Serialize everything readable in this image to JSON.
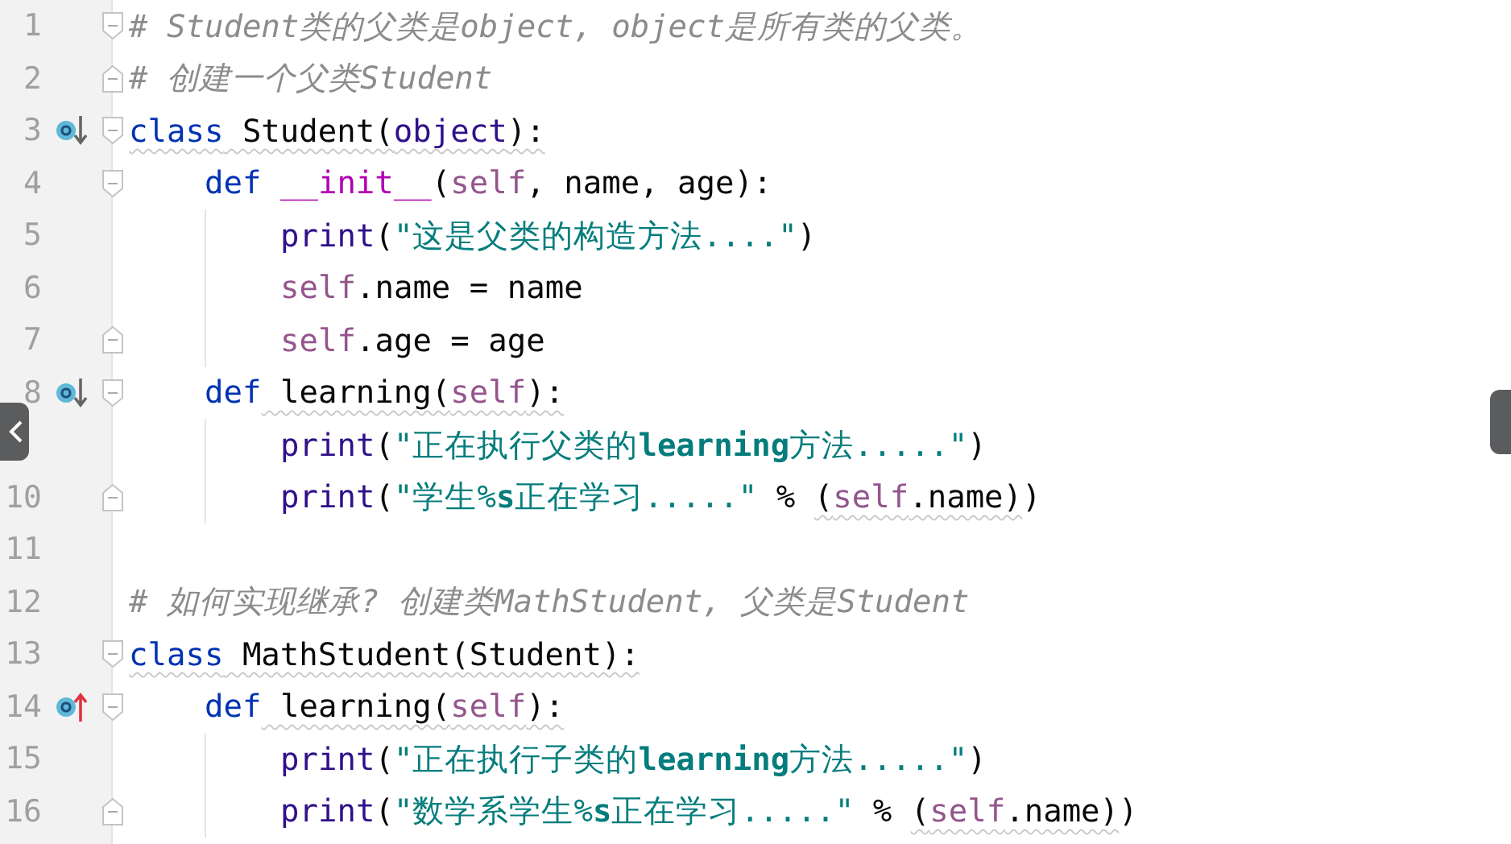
{
  "editor": {
    "lines": [
      {
        "number": "1",
        "fold_start": true,
        "fold_end": false,
        "overridden": false,
        "overrides": false,
        "tokens": [
          {
            "kind": "comment",
            "text": "# Student类的父类是object, object是所有类的父类。"
          }
        ]
      },
      {
        "number": "2",
        "fold_start": false,
        "fold_end": true,
        "overridden": false,
        "overrides": false,
        "tokens": [
          {
            "kind": "comment",
            "text": "# 创建一个父类Student"
          }
        ]
      },
      {
        "number": "3",
        "fold_start": true,
        "fold_end": false,
        "overridden": true,
        "overrides": false,
        "tokens": [
          {
            "kind": "keyword",
            "text": "class",
            "underline": true
          },
          {
            "kind": "plain",
            "text": " Student(",
            "underline": true
          },
          {
            "kind": "builtin",
            "text": "object",
            "underline": true
          },
          {
            "kind": "plain",
            "text": "):",
            "underline": true
          }
        ],
        "children": [
          {
            "number": "4",
            "fold_start": true,
            "fold_end": false,
            "overridden": false,
            "overrides": false,
            "tokens": [
              {
                "kind": "keyword",
                "text": "def"
              },
              {
                "kind": "magic",
                "text": " __init__"
              },
              {
                "kind": "plain",
                "text": "("
              },
              {
                "kind": "self",
                "text": "self"
              },
              {
                "kind": "plain",
                "text": ", name, age):"
              }
            ],
            "children": [
              {
                "number": "5",
                "fold_start": false,
                "fold_end": false,
                "overridden": false,
                "overrides": false,
                "tokens": [
                  {
                    "kind": "builtin",
                    "text": "print"
                  },
                  {
                    "kind": "plain",
                    "text": "("
                  },
                  {
                    "kind": "string",
                    "text": "\"这是父类的构造方法....\""
                  },
                  {
                    "kind": "plain",
                    "text": ")"
                  }
                ]
              },
              {
                "number": "6",
                "fold_start": false,
                "fold_end": false,
                "overridden": false,
                "overrides": false,
                "tokens": [
                  {
                    "kind": "self",
                    "text": "self"
                  },
                  {
                    "kind": "plain",
                    "text": ".name = name"
                  }
                ]
              },
              {
                "number": "7",
                "fold_start": false,
                "fold_end": true,
                "overridden": false,
                "overrides": false,
                "tokens": [
                  {
                    "kind": "self",
                    "text": "self"
                  },
                  {
                    "kind": "plain",
                    "text": ".age = age"
                  }
                ]
              }
            ]
          },
          {
            "number": "8",
            "fold_start": true,
            "fold_end": false,
            "overridden": true,
            "overrides": false,
            "tokens": [
              {
                "kind": "keyword",
                "text": "def"
              },
              {
                "kind": "plain",
                "text": " learning(",
                "underline": true
              },
              {
                "kind": "self",
                "text": "self",
                "underline": true
              },
              {
                "kind": "plain",
                "text": "):",
                "underline": true
              }
            ],
            "children": [
              {
                "fold_start": false,
                "fold_end": false,
                "overridden": false,
                "overrides": false,
                "tokens": [
                  {
                    "kind": "builtin",
                    "text": "print"
                  },
                  {
                    "kind": "plain",
                    "text": "("
                  },
                  {
                    "kind": "string",
                    "text": "\"正在执行父类的**learning**方法.....\""
                  },
                  {
                    "kind": "plain",
                    "text": ")"
                  }
                ]
              },
              {
                "number": "10",
                "fold_start": false,
                "fold_end": true,
                "overridden": false,
                "overrides": false,
                "tokens": [
                  {
                    "kind": "builtin",
                    "text": "print"
                  },
                  {
                    "kind": "plain",
                    "text": "("
                  },
                  {
                    "kind": "string",
                    "text": "\"学生%**s**正在学习.....\""
                  },
                  {
                    "kind": "plain",
                    "text": " % "
                  },
                  {
                    "kind": "plain",
                    "text": "(",
                    "underline": true
                  },
                  {
                    "kind": "self",
                    "text": "self",
                    "underline": true
                  },
                  {
                    "kind": "plain",
                    "text": ".name)",
                    "underline": true
                  },
                  {
                    "kind": "plain",
                    "text": ")"
                  }
                ]
              }
            ]
          }
        ]
      },
      {
        "number": "11",
        "fold_start": false,
        "fold_end": false,
        "overridden": false,
        "overrides": false
      },
      {
        "number": "12",
        "fold_start": false,
        "fold_end": false,
        "overridden": false,
        "overrides": false,
        "tokens": [
          {
            "kind": "comment",
            "text": "# 如何实现继承? 创建类MathStudent, 父类是Student"
          }
        ]
      },
      {
        "number": "13",
        "fold_start": true,
        "fold_end": false,
        "overridden": false,
        "overrides": false,
        "tokens": [
          {
            "kind": "keyword",
            "text": "class",
            "underline": true
          },
          {
            "kind": "plain",
            "text": " MathStudent(Student):",
            "underline": true
          }
        ],
        "children": [
          {
            "number": "14",
            "fold_start": true,
            "fold_end": false,
            "overridden": false,
            "overrides": true,
            "tokens": [
              {
                "kind": "keyword",
                "text": "def"
              },
              {
                "kind": "plain",
                "text": " learning(",
                "underline": true
              },
              {
                "kind": "self",
                "text": "self",
                "underline": true
              },
              {
                "kind": "plain",
                "text": "):",
                "underline": true
              }
            ],
            "children": [
              {
                "number": "15",
                "fold_start": false,
                "fold_end": false,
                "overridden": false,
                "overrides": false,
                "tokens": [
                  {
                    "kind": "builtin",
                    "text": "print"
                  },
                  {
                    "kind": "plain",
                    "text": "("
                  },
                  {
                    "kind": "string",
                    "text": "\"正在执行子类的**learning**方法.....\""
                  },
                  {
                    "kind": "plain",
                    "text": ")"
                  }
                ]
              },
              {
                "number": "16",
                "fold_start": false,
                "fold_end": true,
                "overridden": false,
                "overrides": false,
                "tokens": [
                  {
                    "kind": "builtin",
                    "text": "print"
                  },
                  {
                    "kind": "plain",
                    "text": "("
                  },
                  {
                    "kind": "string",
                    "text": "\"数学系学生%**s**正在学习.....\""
                  },
                  {
                    "kind": "plain",
                    "text": " % "
                  },
                  {
                    "kind": "plain",
                    "text": "(",
                    "underline": true
                  },
                  {
                    "kind": "self",
                    "text": "self",
                    "underline": true
                  },
                  {
                    "kind": "plain",
                    "text": ".name)",
                    "underline": true
                  },
                  {
                    "kind": "plain",
                    "text": ")"
                  }
                ]
              }
            ]
          }
        ]
      }
    ]
  }
}
